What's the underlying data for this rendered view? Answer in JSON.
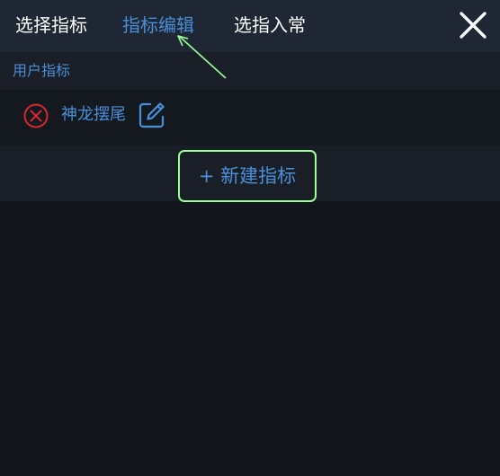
{
  "tabs": [
    {
      "label": "选择指标",
      "active": false
    },
    {
      "label": "指标编辑",
      "active": true
    },
    {
      "label": "选指入常",
      "active": false
    }
  ],
  "close_icon": "close-icon",
  "section": {
    "title": "用户指标"
  },
  "items": [
    {
      "label": "神龙摆尾",
      "delete_icon": "delete-circle-icon",
      "edit_icon": "edit-icon"
    }
  ],
  "add_button": {
    "label": "+ 新建指标"
  },
  "colors": {
    "top_bar": "#1e2733",
    "background": "#12151c",
    "accent_blue": "#4a8fd8",
    "delete_red": "#d8282f",
    "highlight_green": "#9cff9a",
    "text_white": "#ffffff"
  }
}
